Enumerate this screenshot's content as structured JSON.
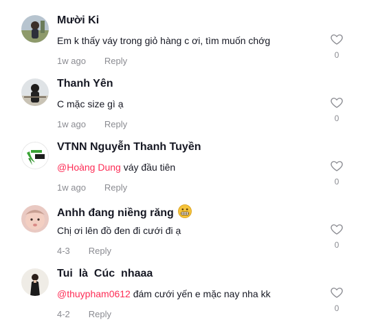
{
  "comments": [
    {
      "username": "Mười Ki",
      "mention": "",
      "text": "Em k thấy váy trong giỏ hàng c ơi, tìm muốn chớg",
      "date": "1w ago",
      "reply_label": "Reply",
      "likes": "0",
      "avatar_icon": "user-photo-avatar"
    },
    {
      "username": "Thanh Yên",
      "mention": "",
      "text": "C mặc size gì ạ",
      "date": "1w ago",
      "reply_label": "Reply",
      "likes": "0",
      "avatar_icon": "user-photo-avatar"
    },
    {
      "username": "VTNN Nguyễn Thanh Tuyền",
      "mention": "@Hoàng Dung",
      "text": " váy đầu tiên",
      "date": "1w ago",
      "reply_label": "Reply",
      "likes": "0",
      "avatar_icon": "vtnn-logo-avatar"
    },
    {
      "username": "Anhh đang niềng răng",
      "mention": "",
      "text": "Chị ơi lên đồ đen đi cưới đi ạ",
      "date": "4-3",
      "reply_label": "Reply",
      "likes": "0",
      "avatar_icon": "baby-photo-avatar",
      "emoji": "grimacing-emoji"
    },
    {
      "username": "Tui  là  Cúc  nhaaa",
      "mention": "@thuypham0612",
      "text": " đám cưới yến e mặc nay nha kk",
      "date": "4-2",
      "reply_label": "Reply",
      "likes": "0",
      "avatar_icon": "user-photo-avatar"
    }
  ],
  "colors": {
    "name": "#161823",
    "text": "#161823",
    "meta": "#8a8b91",
    "mention": "#fe2c55",
    "heart_outline": "#8a8b91"
  }
}
